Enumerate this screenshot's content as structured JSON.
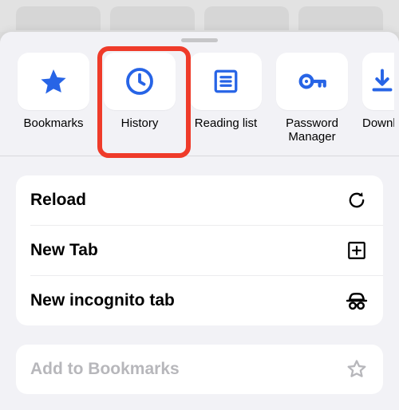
{
  "colors": {
    "accent": "#2563eb",
    "highlight": "#ef3b2a",
    "disabled": "#b7b7bb"
  },
  "top_row": {
    "bookmarks": "Bookmarks",
    "history": "History",
    "reading_list": "Reading list",
    "password_manager": "Password\nManager",
    "downloads": "Downl"
  },
  "menu": {
    "reload": "Reload",
    "new_tab": "New Tab",
    "new_incognito": "New incognito tab",
    "add_bookmarks": "Add to Bookmarks"
  },
  "highlighted_item": "history"
}
